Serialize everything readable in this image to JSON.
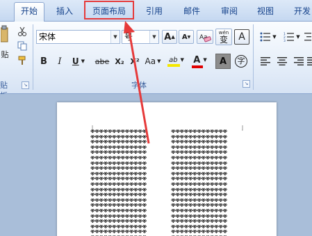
{
  "tabs": [
    {
      "label": "开始",
      "active": true
    },
    {
      "label": "插入",
      "active": false
    },
    {
      "label": "页面布局",
      "active": false
    },
    {
      "label": "引用",
      "active": false
    },
    {
      "label": "邮件",
      "active": false
    },
    {
      "label": "审阅",
      "active": false
    },
    {
      "label": "视图",
      "active": false
    },
    {
      "label": "开发",
      "active": false
    }
  ],
  "clipboard": {
    "paste_partial": "贴",
    "group_partial": "贴板",
    "icons": [
      "scissors-icon",
      "copy-icon",
      "format-painter-icon"
    ]
  },
  "font": {
    "font_name": "宋体",
    "font_size_partial": "号",
    "group_label": "字体",
    "grow_font": "A",
    "shrink_font": "A",
    "bold": "B",
    "italic": "I",
    "underline": "U",
    "strikethrough": "abe",
    "subscript": "X₂",
    "superscript": "X²",
    "change_case": "Aa",
    "highlight_glyph": "ab",
    "font_color_glyph": "A",
    "char_shading_glyph": "A",
    "enclose_char": "字",
    "phonetic": "wén",
    "phonetic_char": "变",
    "char_border": "A",
    "colors": {
      "highlight": "#f5e800",
      "font_color": "#e00000",
      "shading": "#7f7f7f"
    }
  },
  "annotation": {
    "color": "#e63a3a",
    "target_tab": "页面布局"
  },
  "document": {
    "line_text": "※※※※※※※※※※※※※"
  }
}
